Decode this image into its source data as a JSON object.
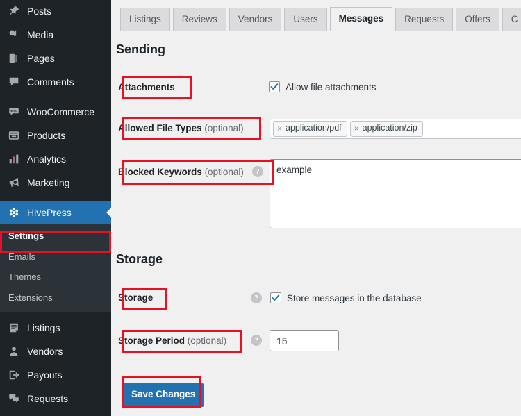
{
  "sidebar": {
    "items": [
      {
        "label": "Posts",
        "icon": "pin-icon"
      },
      {
        "label": "Media",
        "icon": "media-icon"
      },
      {
        "label": "Pages",
        "icon": "pages-icon"
      },
      {
        "label": "Comments",
        "icon": "comments-icon"
      },
      {
        "label": "WooCommerce",
        "icon": "woocommerce-icon"
      },
      {
        "label": "Products",
        "icon": "products-icon"
      },
      {
        "label": "Analytics",
        "icon": "analytics-icon"
      },
      {
        "label": "Marketing",
        "icon": "marketing-icon"
      },
      {
        "label": "HivePress",
        "icon": "hivepress-icon"
      },
      {
        "label": "Listings",
        "icon": "listings-icon"
      },
      {
        "label": "Vendors",
        "icon": "vendors-icon"
      },
      {
        "label": "Payouts",
        "icon": "payouts-icon"
      },
      {
        "label": "Requests",
        "icon": "requests-icon"
      }
    ],
    "submenu": [
      {
        "label": "Settings",
        "active": true
      },
      {
        "label": "Emails",
        "active": false
      },
      {
        "label": "Themes",
        "active": false
      },
      {
        "label": "Extensions",
        "active": false
      }
    ],
    "current_menu": "HivePress",
    "accent_color": "#2271b1",
    "background_color": "#1d2327"
  },
  "tabs": [
    {
      "label": "Listings",
      "active": false
    },
    {
      "label": "Reviews",
      "active": false
    },
    {
      "label": "Vendors",
      "active": false
    },
    {
      "label": "Users",
      "active": false
    },
    {
      "label": "Messages",
      "active": true
    },
    {
      "label": "Requests",
      "active": false
    },
    {
      "label": "Offers",
      "active": false
    },
    {
      "label": "C",
      "active": false
    }
  ],
  "sections": {
    "sending": {
      "title": "Sending",
      "attachments": {
        "label": "Attachments",
        "checkbox_label": "Allow file attachments",
        "checked": true
      },
      "allowed_file_types": {
        "label": "Allowed File Types",
        "optional": "(optional)",
        "tags": [
          "application/pdf",
          "application/zip"
        ],
        "remove_glyph": "×"
      },
      "blocked_keywords": {
        "label": "Blocked Keywords",
        "optional": "(optional)",
        "help": "?",
        "value": "example"
      }
    },
    "storage": {
      "title": "Storage",
      "storage": {
        "label": "Storage",
        "help": "?",
        "checkbox_label": "Store messages in the database",
        "checked": true
      },
      "storage_period": {
        "label": "Storage Period",
        "optional": "(optional)",
        "help": "?",
        "value": "15"
      }
    }
  },
  "actions": {
    "save_label": "Save Changes"
  },
  "annotation_color": "#e81123"
}
